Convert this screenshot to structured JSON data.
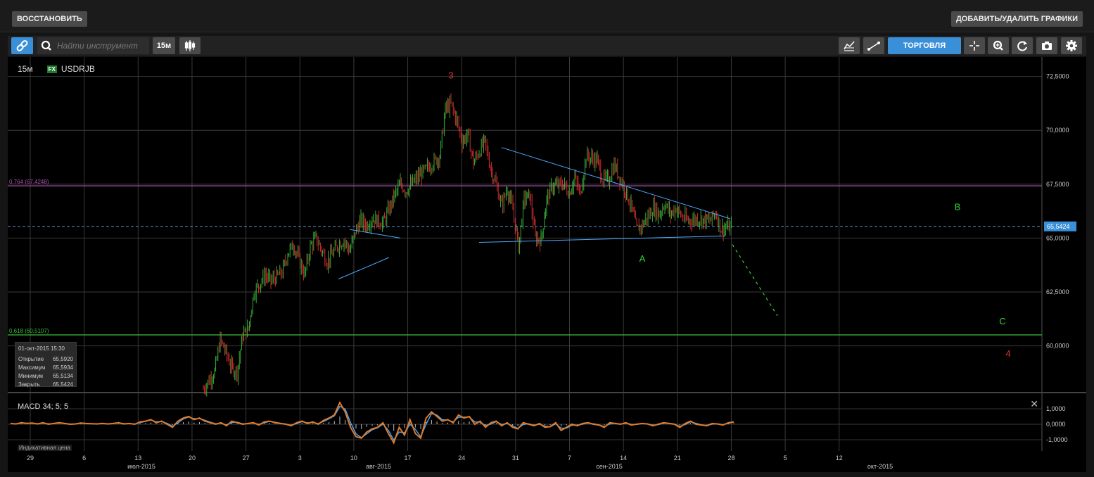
{
  "header": {
    "restore_label": "ВОССТАНОВИТЬ",
    "add_remove_label": "ДОБАВИТЬ/УДАЛИТЬ ГРАФИКИ"
  },
  "toolbar": {
    "search_placeholder": "Найти инструмент",
    "interval_label": "15м",
    "trade_label": "ТОРГОВЛЯ",
    "icons": [
      "link-icon",
      "search-icon",
      "candles-icon",
      "indicators-icon",
      "line-tool-icon",
      "crosshair-icon",
      "zoom-icon",
      "refresh-icon",
      "camera-icon",
      "gear-icon"
    ]
  },
  "legend": {
    "interval": "15м",
    "badge": "FX",
    "symbol": "USDRJB"
  },
  "info_box": {
    "date": "01-окт-2015 15:30",
    "rows": [
      {
        "label": "Открытие",
        "value": "65,5920"
      },
      {
        "label": "Максимум",
        "value": "65,5934"
      },
      {
        "label": "Минимум",
        "value": "65,5134"
      },
      {
        "label": "Закрыть",
        "value": "65,5424"
      }
    ]
  },
  "fib_levels": [
    {
      "label": "0,764 (67,4248)",
      "value": 67.4248,
      "color": "#b04fb0"
    },
    {
      "label": "0,618 (60,5107)",
      "value": 60.5107,
      "color": "#3ac03a"
    }
  ],
  "last_price": {
    "label": "65,5424",
    "value": 65.5424
  },
  "wave_labels": [
    {
      "text": "3",
      "color": "#e53030",
      "date": 22,
      "price": 72.4
    },
    {
      "text": "A",
      "color": "#39d039",
      "date": 39,
      "price": 63.9
    },
    {
      "text": "B",
      "color": "#39d039",
      "date": 67,
      "price": 66.3
    },
    {
      "text": "C",
      "color": "#39d039",
      "date": 71,
      "price": 61.0
    },
    {
      "text": "4",
      "color": "#e53030",
      "date": 71.5,
      "price": 59.5
    }
  ],
  "macd": {
    "label": "MACD 34; 5; 5",
    "indicative": "Индикативная цена",
    "ticks": [
      "1,0000",
      "0,0000",
      "-1,0000"
    ]
  },
  "chart_data": {
    "type": "candlestick",
    "symbol": "USDRJB",
    "interval": "15м",
    "y_ticks": [
      "72,5000",
      "70,0000",
      "67,5000",
      "65,0000",
      "62,5000",
      "60,0000"
    ],
    "ylim": [
      57.9,
      73.4
    ],
    "x_day_ticks": [
      "29",
      "6",
      "13",
      "20",
      "27",
      "3",
      "10",
      "17",
      "24",
      "31",
      "7",
      "14",
      "21",
      "28",
      "5",
      "12"
    ],
    "x_month_labels": [
      "июл-2015",
      "авг-2015",
      "сен-2015",
      "окт-2015"
    ],
    "series": [
      {
        "name": "USDRJB",
        "values": [
          [
            0,
            58
          ],
          [
            1,
            58.8
          ],
          [
            1.5,
            60.3
          ],
          [
            2,
            59.7
          ],
          [
            2.5,
            59
          ],
          [
            3,
            58.8
          ],
          [
            3.5,
            60.5
          ],
          [
            4,
            60.8
          ],
          [
            4.5,
            62.5
          ],
          [
            5,
            62.9
          ],
          [
            5.5,
            63.3
          ],
          [
            6,
            63.0
          ],
          [
            7,
            63.4
          ],
          [
            7.5,
            64.3
          ],
          [
            8,
            64.7
          ],
          [
            8.5,
            64.0
          ],
          [
            9,
            63.3
          ],
          [
            9.5,
            64.6
          ],
          [
            10,
            65.0
          ],
          [
            11,
            63.9
          ],
          [
            11.5,
            64.3
          ],
          [
            12,
            64.7
          ],
          [
            12.5,
            64.9
          ],
          [
            13,
            64.4
          ],
          [
            13.5,
            65.3
          ],
          [
            14,
            65.8
          ],
          [
            14.5,
            65.6
          ],
          [
            15,
            65.9
          ],
          [
            16,
            65.7
          ],
          [
            17,
            67.0
          ],
          [
            17.5,
            67.5
          ],
          [
            18,
            67.2
          ],
          [
            19,
            67.8
          ],
          [
            20,
            68.3
          ],
          [
            21,
            68.8
          ],
          [
            21.5,
            71.0
          ],
          [
            22,
            71.2
          ],
          [
            22.5,
            70.5
          ],
          [
            23,
            69.5
          ],
          [
            23.5,
            69.8
          ],
          [
            24,
            68.5
          ],
          [
            25,
            69.5
          ],
          [
            25.5,
            68.3
          ],
          [
            26,
            67.5
          ],
          [
            26.5,
            66.5
          ],
          [
            27,
            67.3
          ],
          [
            27.5,
            66.3
          ],
          [
            28,
            64.6
          ],
          [
            28.5,
            66.8
          ],
          [
            29,
            67.0
          ],
          [
            29.5,
            65.0
          ],
          [
            30,
            64.9
          ],
          [
            30.5,
            66.8
          ],
          [
            31,
            67.4
          ],
          [
            32,
            67.5
          ],
          [
            32.5,
            67.1
          ],
          [
            33,
            67.8
          ],
          [
            33.5,
            67.0
          ],
          [
            34,
            68.8
          ],
          [
            35,
            68.6
          ],
          [
            35.5,
            67.7
          ],
          [
            36,
            67.7
          ],
          [
            36.5,
            68.4
          ],
          [
            37,
            67.8
          ],
          [
            37.5,
            67.2
          ],
          [
            38,
            66.5
          ],
          [
            38.5,
            65.4
          ],
          [
            39,
            65.6
          ],
          [
            39.5,
            66.0
          ],
          [
            40,
            66.4
          ],
          [
            40.5,
            66.1
          ],
          [
            41,
            66.6
          ],
          [
            41.5,
            66.1
          ],
          [
            42,
            66.4
          ],
          [
            42.5,
            66.0
          ],
          [
            43,
            65.8
          ],
          [
            44,
            65.9
          ],
          [
            45,
            65.8
          ],
          [
            45.5,
            66.2
          ],
          [
            46,
            65.4
          ],
          [
            46.5,
            65.5
          ],
          [
            47,
            65.5
          ]
        ]
      }
    ],
    "trendlines": [
      {
        "from": [
          13,
          65.4
        ],
        "to": [
          17.5,
          65.0
        ],
        "color": "#4aa8ff"
      },
      {
        "from": [
          12,
          63.1
        ],
        "to": [
          16.5,
          64.1
        ],
        "color": "#4aa8ff"
      },
      {
        "from": [
          26.5,
          69.2
        ],
        "to": [
          46.8,
          65.9
        ],
        "color": "#4aa8ff"
      },
      {
        "from": [
          24.5,
          64.8
        ],
        "to": [
          46.3,
          65.1
        ],
        "color": "#4aa8ff"
      }
    ],
    "projection": {
      "from": [
        47,
        64.7
      ],
      "to": [
        51,
        61.4
      ],
      "color": "#39d039",
      "style": "dashed"
    },
    "grid": true
  },
  "macd_series": [
    0.05,
    0.02,
    0.1,
    0.05,
    0.08,
    0.02,
    0.1,
    0.0,
    0.05,
    0.1,
    0.05,
    0.0,
    0.02,
    0.08,
    0.05,
    0.03,
    0.02,
    0.06,
    0.02,
    0.05,
    0.1,
    0.02,
    0.05,
    0.0,
    0.15,
    0.2,
    0.3,
    0.1,
    0.2,
    0.0,
    -0.2,
    0.2,
    0.4,
    0.5,
    0.3,
    0.4,
    0.2,
    0.1,
    0.0,
    0.1,
    -0.1,
    0.2,
    0.1,
    0.0,
    0.05,
    0.1,
    -0.05,
    0.15,
    0.2,
    0.1,
    0.05,
    0.0,
    -0.1,
    0.1,
    0.2,
    0.05,
    0.15,
    0.0,
    0.25,
    0.4,
    0.6,
    1.4,
    0.8,
    -0.2,
    -0.8,
    -0.9,
    -0.5,
    -0.3,
    -0.2,
    0.1,
    -0.6,
    -1.2,
    -0.2,
    -0.7,
    0.3,
    -0.6,
    -0.9,
    0.4,
    0.8,
    0.5,
    0.2,
    0.3,
    0.1,
    0.6,
    0.4,
    0.5,
    0.0,
    0.2,
    -0.2,
    0.1,
    0.2,
    -0.1,
    0.1,
    -0.2,
    -0.3,
    0.1,
    0.0,
    -0.1,
    0.05,
    -0.2,
    -0.15,
    0.1,
    -0.4,
    -0.2,
    0.0,
    -0.1,
    0.05,
    0.1,
    0.0,
    -0.05,
    -0.2,
    0.1,
    0.05,
    0.0,
    0.1,
    -0.05,
    0.0,
    0.05,
    0.02,
    -0.1,
    0.0,
    0.1,
    0.05,
    0.0,
    -0.2,
    0.05,
    0.2,
    0.0,
    -0.05,
    -0.1,
    0.05,
    0.02,
    -0.05,
    0.1,
    0.15
  ],
  "colors": {
    "accent": "#3a8fd9",
    "bull": "#3ac03a",
    "bear": "#e03030",
    "macd_line": "#e07a28",
    "signal": "#4aa8ff",
    "last_price_line": "#5f8fd6"
  }
}
